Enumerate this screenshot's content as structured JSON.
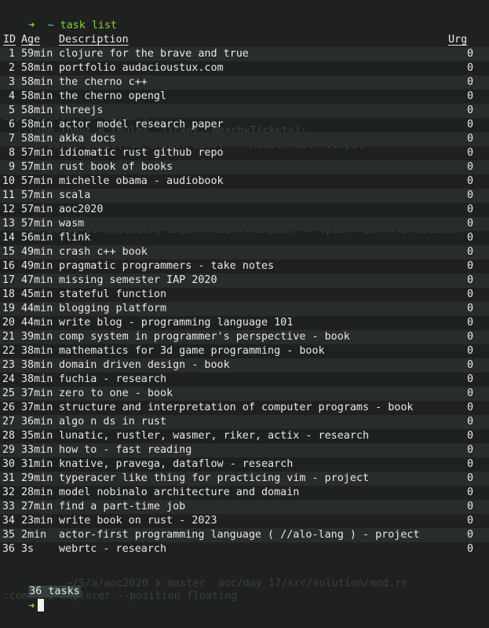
{
  "ghost_lines": [
    {
      "text": "impl Solver for Day16 {"
    },
    {
      "text": "    type Input = (Rules, Ticket, NearbyTickets);"
    },
    {
      "text": "    fn parse_input(raw_input: &str) -> Result<Self::Input>"
    },
    {
      "text": "    fn solve_first(&self, input: &Self::Input) -> Option<Self::Solution1>"
    },
    {
      "text": "~/S/a/aoc2020 ❯ master  aoc/day_17/src/solution/mod.rs"
    },
    {
      "text": ":command explorer --position floating"
    }
  ],
  "prompt": {
    "arrow": "➜",
    "dir": "~",
    "command": "task list"
  },
  "table": {
    "headers": {
      "id": "ID",
      "age": "Age",
      "description": "Description",
      "urg": "Urg"
    },
    "rows": [
      {
        "id": "1",
        "age": "59min",
        "desc": "clojure for the brave and true",
        "urg": "0"
      },
      {
        "id": "2",
        "age": "58min",
        "desc": "portfolio audacioustux.com",
        "urg": "0"
      },
      {
        "id": "3",
        "age": "58min",
        "desc": "the cherno c++",
        "urg": "0"
      },
      {
        "id": "4",
        "age": "58min",
        "desc": "the cherno opengl",
        "urg": "0"
      },
      {
        "id": "5",
        "age": "58min",
        "desc": "threejs",
        "urg": "0"
      },
      {
        "id": "6",
        "age": "58min",
        "desc": "actor model research paper",
        "urg": "0"
      },
      {
        "id": "7",
        "age": "58min",
        "desc": "akka docs",
        "urg": "0"
      },
      {
        "id": "8",
        "age": "57min",
        "desc": "idiomatic rust github repo",
        "urg": "0"
      },
      {
        "id": "9",
        "age": "57min",
        "desc": "rust book of books",
        "urg": "0"
      },
      {
        "id": "10",
        "age": "57min",
        "desc": "michelle obama - audiobook",
        "urg": "0"
      },
      {
        "id": "11",
        "age": "57min",
        "desc": "scala",
        "urg": "0"
      },
      {
        "id": "12",
        "age": "57min",
        "desc": "aoc2020",
        "urg": "0"
      },
      {
        "id": "13",
        "age": "57min",
        "desc": "wasm",
        "urg": "0"
      },
      {
        "id": "14",
        "age": "56min",
        "desc": "flink",
        "urg": "0"
      },
      {
        "id": "15",
        "age": "49min",
        "desc": "crash c++ book",
        "urg": "0"
      },
      {
        "id": "16",
        "age": "49min",
        "desc": "pragmatic programmers - take notes",
        "urg": "0"
      },
      {
        "id": "17",
        "age": "47min",
        "desc": "missing semester IAP 2020",
        "urg": "0"
      },
      {
        "id": "18",
        "age": "45min",
        "desc": "stateful function",
        "urg": "0"
      },
      {
        "id": "19",
        "age": "44min",
        "desc": "blogging platform",
        "urg": "0"
      },
      {
        "id": "20",
        "age": "44min",
        "desc": "write blog - programming language 101",
        "urg": "0"
      },
      {
        "id": "21",
        "age": "39min",
        "desc": "comp system in programmer's perspective - book",
        "urg": "0"
      },
      {
        "id": "22",
        "age": "38min",
        "desc": "mathematics for 3d game programming - book",
        "urg": "0"
      },
      {
        "id": "23",
        "age": "38min",
        "desc": "domain driven design - book",
        "urg": "0"
      },
      {
        "id": "24",
        "age": "38min",
        "desc": "fuchia - research",
        "urg": "0"
      },
      {
        "id": "25",
        "age": "37min",
        "desc": "zero to one - book",
        "urg": "0"
      },
      {
        "id": "26",
        "age": "37min",
        "desc": "structure and interpretation of computer programs - book",
        "urg": "0"
      },
      {
        "id": "27",
        "age": "36min",
        "desc": "algo n ds in rust",
        "urg": "0"
      },
      {
        "id": "28",
        "age": "35min",
        "desc": "lunatic, rustler, wasmer, riker, actix - research",
        "urg": "0"
      },
      {
        "id": "29",
        "age": "33min",
        "desc": "how to - fast reading",
        "urg": "0"
      },
      {
        "id": "30",
        "age": "31min",
        "desc": "knative, pravega, dataflow - research",
        "urg": "0"
      },
      {
        "id": "31",
        "age": "29min",
        "desc": "typeracer like thing for practicing vim - project",
        "urg": "0"
      },
      {
        "id": "32",
        "age": "28min",
        "desc": "model nobinalo architecture and domain",
        "urg": "0"
      },
      {
        "id": "33",
        "age": "27min",
        "desc": "find a part-time job",
        "urg": "0"
      },
      {
        "id": "34",
        "age": "23min",
        "desc": "write book on rust - 2023",
        "urg": "0"
      },
      {
        "id": "35",
        "age": "2min",
        "desc": "actor-first programming language ( //alo-lang ) - project",
        "urg": "0"
      },
      {
        "id": "36",
        "age": "3s",
        "desc": "webrtc - research",
        "urg": "0"
      }
    ]
  },
  "summary": "36 tasks",
  "prompt2": {
    "arrow": "➜"
  },
  "colors": {
    "background": "#1e2120",
    "row_alt": "#282c2a",
    "prompt_green": "#8bd22e",
    "tilde_cyan": "#4fd0c8"
  }
}
